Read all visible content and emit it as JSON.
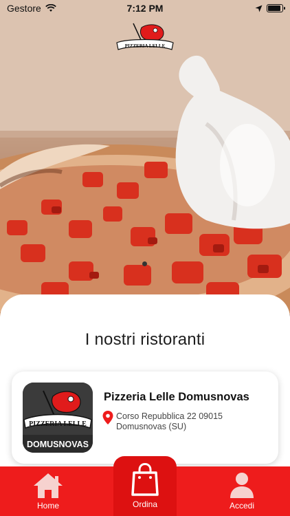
{
  "status_bar": {
    "carrier": "Gestore",
    "time": "7:12 PM",
    "icons": [
      "wifi-icon",
      "location-arrow-icon",
      "battery-icon"
    ],
    "battery_level": 0.9
  },
  "brand": {
    "logo_text": "PIZZERIA LELLE",
    "accent_color": "#ee1c1c"
  },
  "hero": {
    "image_description_icon": "pizza-burrata-photo",
    "pager_active_index": 0
  },
  "main": {
    "title": "I nostri ristoranti",
    "restaurants": [
      {
        "name": "Pizzeria Lelle Domusnovas",
        "address_line1": "Corso Repubblica 22 09015",
        "address_line2": "Domusnovas (SU)",
        "logo_text_top": "PIZZERIA LELLE",
        "logo_text_bottom": "DOMUSNOVAS"
      }
    ]
  },
  "tabbar": {
    "home_label": "Home",
    "order_label": "Ordina",
    "login_label": "Accedi"
  }
}
